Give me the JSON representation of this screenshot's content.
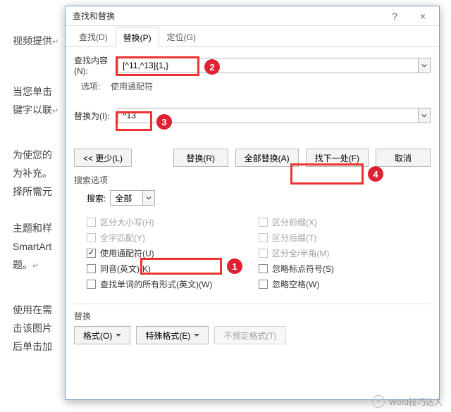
{
  "bg": {
    "p1": "视频提供",
    "p2a": "当您单击",
    "p2b": "键字以联",
    "p3a": "为使您的",
    "p3b": "为补充。",
    "p3c": "择所需元",
    "p4a": "主题和样",
    "p4b": "SmartArt",
    "p4c": "题。",
    "p5a": "使用在需",
    "p5b": "击该图片",
    "p5c": "后单击加"
  },
  "dialog": {
    "title": "查找和替换",
    "help": "?",
    "close": "×",
    "tabs": {
      "find": "查找(D)",
      "replace": "替换(P)",
      "goto": "定位(G)"
    },
    "find_label": "查找内容(N):",
    "find_value": "[^11,^13]{1,}",
    "opt_label": "选项:",
    "opt_value": "使用通配符",
    "replace_label": "替换为(I):",
    "replace_value": "^13",
    "buttons": {
      "less": "<< 更少(L)",
      "replace": "替换(R)",
      "replace_all": "全部替换(A)",
      "find_next": "找下一处(F)",
      "cancel": "取消"
    },
    "search_section": "搜索选项",
    "search_label": "搜索:",
    "search_value": "全部",
    "checks_left": {
      "case": "区分大小写(H)",
      "whole": "全字匹配(Y)",
      "wildcard": "使用通配符(U)",
      "sounds": "同音(英文)(K)",
      "forms": "查找单词的所有形式(英文)(W)"
    },
    "checks_right": {
      "prefix": "区分前缀(X)",
      "suffix": "区分后缀(T)",
      "width": "区分全/半角(M)",
      "punct": "忽略标点符号(S)",
      "space": "忽略空格(W)"
    },
    "replace_section": "替换",
    "bottom": {
      "format": "格式(O)",
      "special": "特殊格式(E)",
      "noformat": "不预定格式(T)"
    }
  },
  "watermark": "Word技巧达人"
}
